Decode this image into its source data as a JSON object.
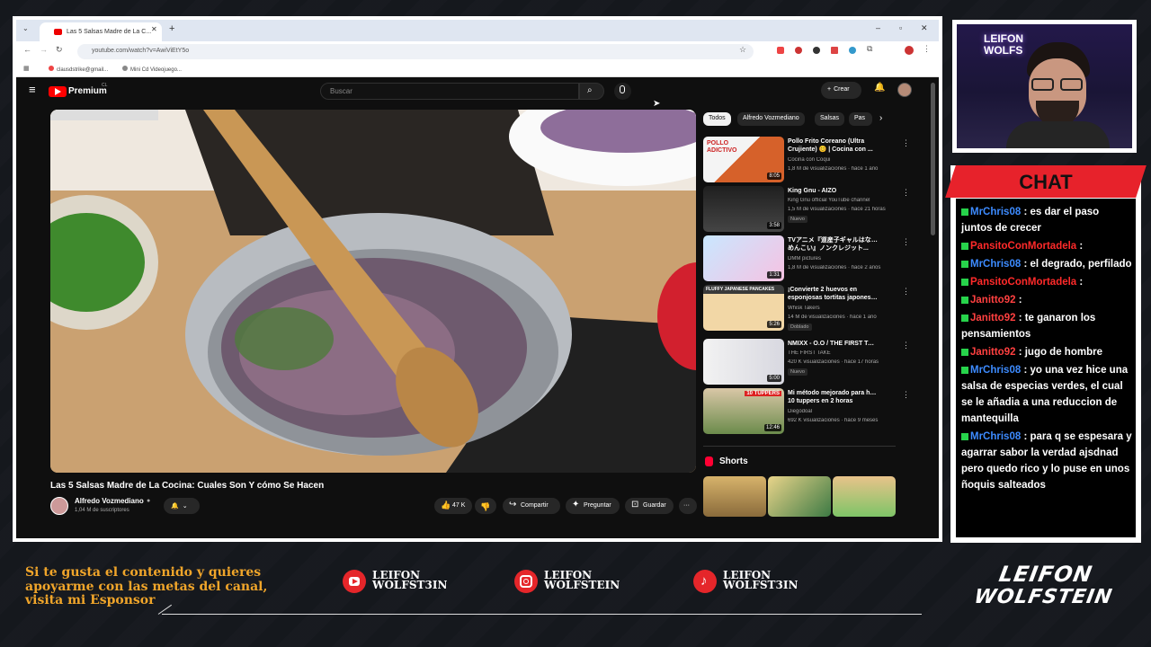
{
  "browser": {
    "tab_title": "Las 5 Salsas Madre de La C...",
    "new_tab": "+",
    "url": "youtube.com/watch?v=AwiViEtY5o",
    "bookmarks": [
      "clausdstrike@gmail...",
      "Mini Cd Videojuego..."
    ]
  },
  "youtube": {
    "brand": "Premium",
    "brand_sup": "CL",
    "search_placeholder": "Buscar",
    "create_label": "Crear",
    "video_title": "Las 5 Salsas Madre de La Cocina: Cuales Son Y cómo Se Hacen",
    "channel_name": "Alfredo Vozmediano",
    "subscribers": "1,04 M de suscriptores",
    "likes": "47 K",
    "share_label": "Compartir",
    "ask_label": "Preguntar",
    "save_label": "Guardar",
    "more_label": "···",
    "chips": [
      "Todos",
      "Alfredo Vozmediano",
      "Salsas",
      "Pas"
    ],
    "recommendations": [
      {
        "title1": "Pollo Frito Coreano (Ultra",
        "title2": "Crujiente) 😊 | Cocina con ...",
        "channel": "Cocina con Coqui",
        "meta": "1,8 M de visualizaciones · hace 1 año",
        "duration": "8:05",
        "badge": ""
      },
      {
        "title1": "King Gnu - AIZO",
        "title2": "",
        "channel": "King Gnu official YouTube channel",
        "meta": "1,5 M de visualizaciones · hace 21 horas",
        "duration": "3:58",
        "badge": "Nuevo"
      },
      {
        "title1": "TVアニメ『道産子ギャルはなまら",
        "title2": "めんこい』ノンクレジット...",
        "channel": "DMM pictures",
        "meta": "1,8 M de visualizaciones · hace 2 años",
        "duration": "1:31",
        "badge": ""
      },
      {
        "title1": "¡Convierte 2 huevos en",
        "title2": "esponjosas tortitas japonesas ...",
        "channel": "Whisk Takers",
        "meta": "14 M de visualizaciones · hace 1 año",
        "duration": "5:26",
        "badge": "Doblado"
      },
      {
        "title1": "NMIXX - O.O / THE FIRST TAKE",
        "title2": "",
        "channel": "THE FIRST TAKE",
        "meta": "420 K visualizaciones · hace 17 horas",
        "duration": "5:00",
        "badge": "Nuevo"
      },
      {
        "title1": "Mi método mejorado para hacer",
        "title2": "10 tuppers en 2 horas",
        "channel": "Diegodoal",
        "meta": "692 K visualizaciones · hace 9 meses",
        "duration": "12:46",
        "badge": ""
      }
    ],
    "thumb_text": [
      "POLLO ADICTIVO",
      "",
      "",
      "FLUFFY JAPANESE PANCAKES",
      "",
      "10 TUPPERS"
    ],
    "shorts_label": "Shorts"
  },
  "chat": {
    "title": "CHAT",
    "messages": [
      {
        "user": "MrChris08",
        "color": "#3d8bff",
        "text": "es dar el paso juntos de crecer"
      },
      {
        "user": "PansitoConMortadela",
        "color": "#ff2a2a",
        "text": ""
      },
      {
        "user": "MrChris08",
        "color": "#3d8bff",
        "text": "el degrado, perfilado"
      },
      {
        "user": "PansitoConMortadela",
        "color": "#ff2a2a",
        "text": ""
      },
      {
        "user": "Janitto92",
        "color": "#ff4040",
        "text": ""
      },
      {
        "user": "Janitto92",
        "color": "#ff4040",
        "text": "te ganaron los pensamientos"
      },
      {
        "user": "Janitto92",
        "color": "#ff4040",
        "text": "jugo de hombre"
      },
      {
        "user": "MrChris08",
        "color": "#3d8bff",
        "text": "yo una vez hice una salsa de especias verdes, el cual se le añadia a una reduccion de mantequilla"
      },
      {
        "user": "MrChris08",
        "color": "#3d8bff",
        "text": "para q se espesara y agarrar sabor la verdad ajsdnad pero quedo rico y lo puse en unos ñoquis salteados"
      }
    ]
  },
  "overlay": {
    "support_text": "Si te gusta el contenido y quieres apoyarme con las metas del canal, visita mi Esponsor",
    "socials": [
      {
        "network": "youtube",
        "line1": "LEIFON",
        "line2": "WOLFST3IN",
        "color": "#e5262a"
      },
      {
        "network": "instagram",
        "line1": "LEIFON",
        "line2": "WOLFSTEIN",
        "color": "#e5262a"
      },
      {
        "network": "tiktok",
        "line1": "LEIFON",
        "line2": "WOLFST3IN",
        "color": "#e5262a"
      }
    ],
    "brand_line1": "LEIFON",
    "brand_line2": "WOLFSTEIN",
    "cam_sign": "LEIFON WOLFS"
  }
}
